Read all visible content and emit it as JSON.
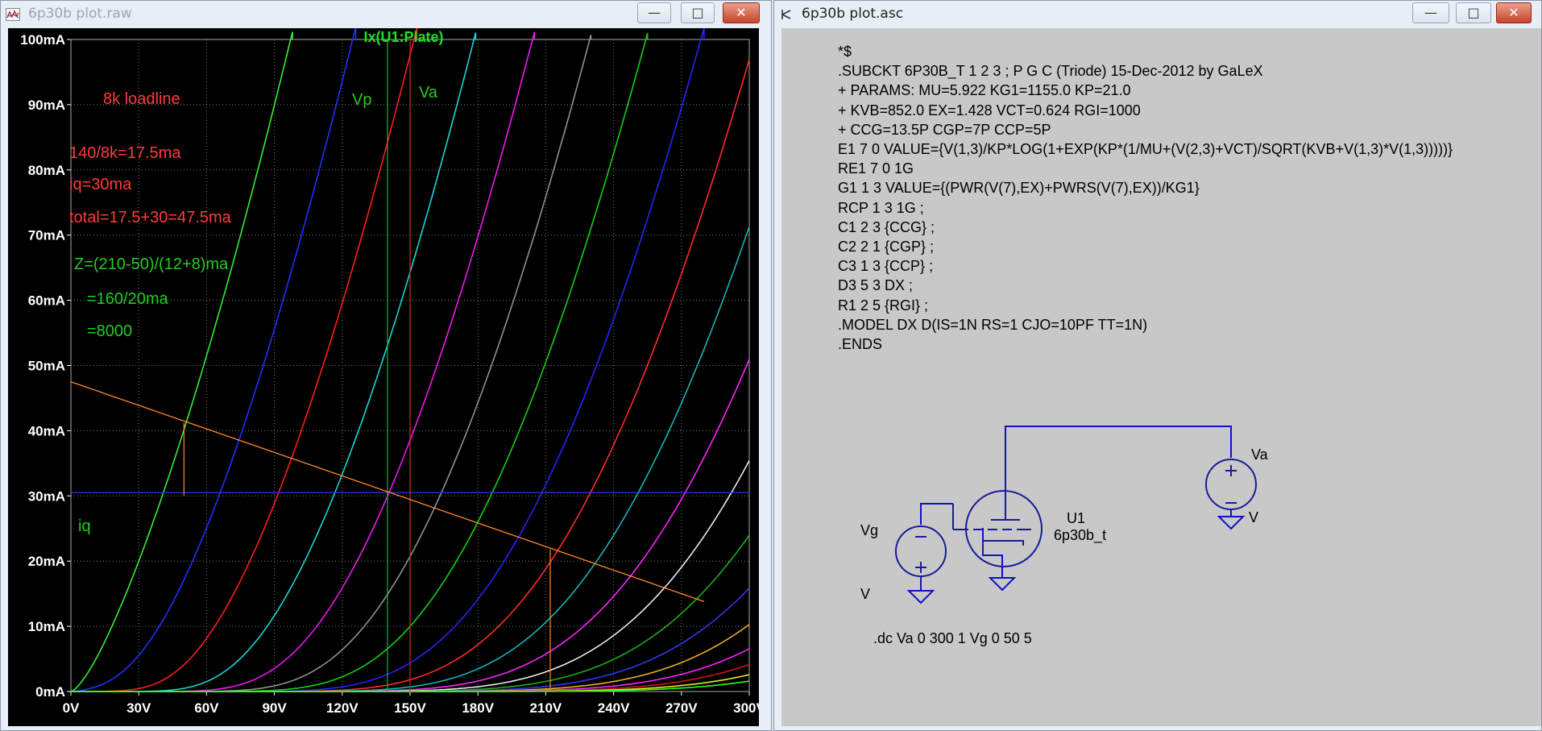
{
  "plot_window": {
    "title": "6p30b plot.raw",
    "buttons": {
      "minimize": "—",
      "maximize": "□",
      "close": "✕"
    },
    "icons": {
      "app": "waveform-plot-icon"
    },
    "colors": {
      "background": "#000000",
      "grid": "#7a7a7a",
      "axis_text": "#ffffff"
    }
  },
  "chart_data": {
    "type": "line",
    "title": "Ix(U1:Plate)",
    "xlabel": "",
    "ylabel": "",
    "xlim": [
      0,
      300
    ],
    "ylim": [
      0,
      100
    ],
    "grid": true,
    "x_ticks": [
      "0V",
      "30V",
      "60V",
      "90V",
      "120V",
      "150V",
      "180V",
      "210V",
      "240V",
      "270V",
      "300V"
    ],
    "y_ticks": [
      "0mA",
      "10mA",
      "20mA",
      "30mA",
      "40mA",
      "50mA",
      "60mA",
      "70mA",
      "80mA",
      "90mA",
      "100mA"
    ],
    "curve_model": {
      "mu": 5.922,
      "kg1": 1155.0,
      "kp": 21.0,
      "kvb": 852.0,
      "ex": 1.428,
      "vct": 0.624
    },
    "series": [
      {
        "vg": 0,
        "color": "#33ee33"
      },
      {
        "vg": 5,
        "color": "#1f2fff"
      },
      {
        "vg": 10,
        "color": "#ff1b1b"
      },
      {
        "vg": 15,
        "color": "#18d6d6"
      },
      {
        "vg": 20,
        "color": "#ee18ee"
      },
      {
        "vg": 25,
        "color": "#909090"
      },
      {
        "vg": 30,
        "color": "#12d012"
      },
      {
        "vg": 35,
        "color": "#2323ff"
      },
      {
        "vg": 40,
        "color": "#ff2a2a"
      },
      {
        "vg": 45,
        "color": "#12b5b5"
      },
      {
        "vg": 50,
        "color": "#ff22ff"
      },
      {
        "vg": 55,
        "color": "#ececec"
      },
      {
        "vg": 60,
        "color": "#18b018"
      },
      {
        "vg": 65,
        "color": "#3535f0"
      },
      {
        "vg": 70,
        "color": "#e8b020"
      },
      {
        "vg": 75,
        "color": "#ff22ff"
      },
      {
        "vg": 80,
        "color": "#c81818"
      },
      {
        "vg": 85,
        "color": "#e8e822"
      },
      {
        "vg": 90,
        "color": "#22ff22"
      }
    ],
    "loadline": {
      "points": [
        [
          0,
          47.5
        ],
        [
          280,
          13.8
        ]
      ],
      "color": "#ff8a2a"
    },
    "hline_iq": {
      "y": 30.5,
      "color": "#2a3ad8"
    },
    "vlines": [
      {
        "x": 140,
        "color": "#20b040"
      },
      {
        "x": 150,
        "color": "#e02020"
      }
    ],
    "markers": [
      {
        "x": 50,
        "y0": 41.2,
        "y1": 30.0,
        "color": "#ff8a2a"
      },
      {
        "x": 212,
        "y0": 21.8,
        "y1": 0,
        "color": "#ff8a2a"
      }
    ],
    "annotations": [
      {
        "text": "8k loadline",
        "color": "#ff3a3a"
      },
      {
        "text": "140/8k=17.5ma",
        "color": "#ff3a3a"
      },
      {
        "text": "iq=30ma",
        "color": "#ff3a3a"
      },
      {
        "text": "total=17.5+30=47.5ma",
        "color": "#ff3a3a"
      },
      {
        "text": "Z=(210-50)/(12+8)ma",
        "color": "#22cc22"
      },
      {
        "text": "=160/20ma",
        "color": "#22cc22"
      },
      {
        "text": "=8000",
        "color": "#22cc22"
      },
      {
        "text": "Vp",
        "color": "#22cc22"
      },
      {
        "text": "Va",
        "color": "#22cc22"
      },
      {
        "text": "iq",
        "color": "#22cc22"
      }
    ]
  },
  "asc_window": {
    "title": "6p30b plot.asc",
    "buttons": {
      "minimize": "—",
      "maximize": "□",
      "close": "✕"
    },
    "icons": {
      "app": "schematic-icon"
    },
    "netlist": [
      "*$",
      ".SUBCKT 6P30B_T 1 2 3 ; P G C (Triode) 15-Dec-2012 by GaLeX",
      "+ PARAMS: MU=5.922 KG1=1155.0 KP=21.0",
      "+ KVB=852.0 EX=1.428 VCT=0.624 RGI=1000",
      "+ CCG=13.5P CGP=7P CCP=5P",
      "E1 7 0 VALUE={V(1,3)/KP*LOG(1+EXP(KP*(1/MU+(V(2,3)+VCT)/SQRT(KVB+V(1,3)*V(1,3)))))}",
      "RE1 7 0 1G",
      "G1 1 3 VALUE={(PWR(V(7),EX)+PWRS(V(7),EX))/KG1}",
      "RCP 1 3 1G ;",
      "C1 2 3 {CCG} ;",
      "C2 2 1 {CGP} ;",
      "C3 1 3 {CCP} ;",
      "D3 5 3 DX ;",
      "R1 2 5 {RGI} ;",
      ".MODEL DX D(IS=1N RS=1 CJO=10PF TT=1N)",
      ".ENDS"
    ],
    "schematic": {
      "va_name": "Va",
      "va_value": "V",
      "vg_name": "Vg",
      "vg_value": "V",
      "tube_name": "U1",
      "tube_model": "6p30b_t",
      "wire_color": "#1010c8",
      "symbol_color": "#1a1a9a",
      "ground_icon": "ground-icon",
      "source_icon": "voltage-source-icon",
      "tube_icon": "triode-tube-icon"
    },
    "dc_statement": ".dc Va 0 300 1 Vg 0 50 5"
  }
}
